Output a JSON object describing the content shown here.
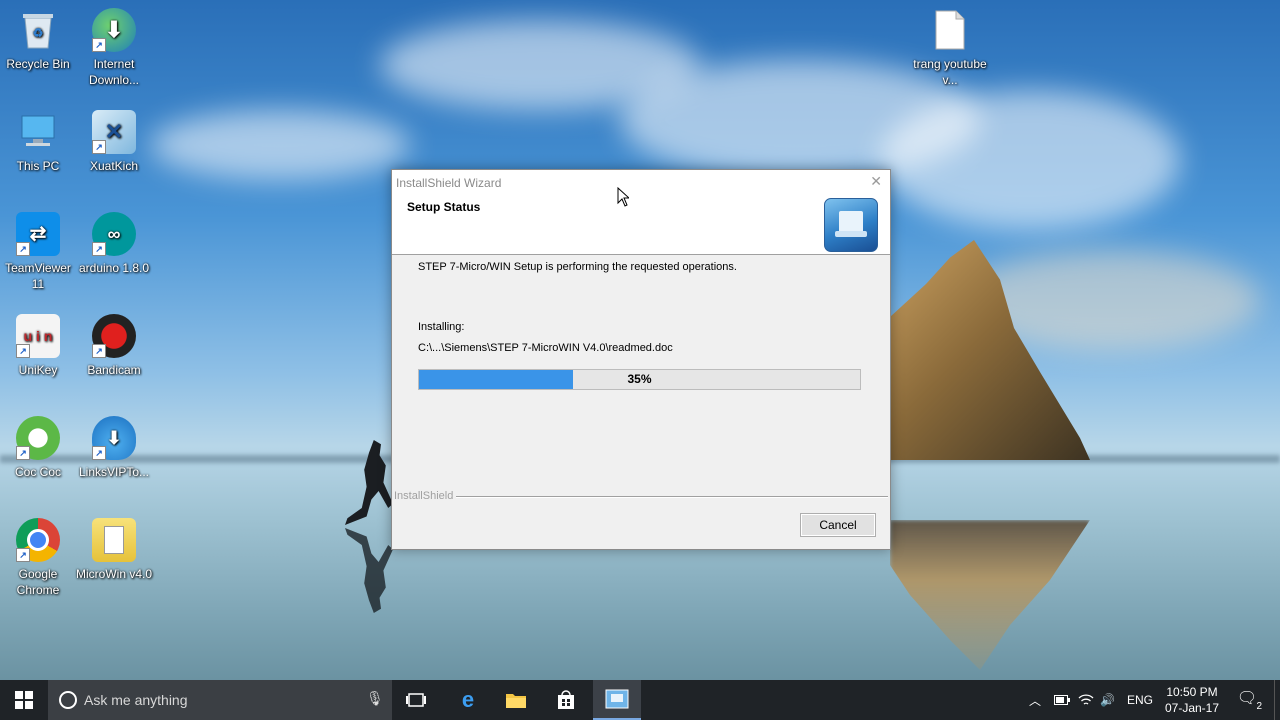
{
  "desktop": {
    "icons": [
      {
        "label": "Recycle Bin",
        "icon": "recycle-bin-icon"
      },
      {
        "label": "Internet Downlo...",
        "icon": "internet-download-manager-icon"
      },
      {
        "label": "This PC",
        "icon": "this-pc-icon"
      },
      {
        "label": "XuatKich",
        "icon": "xuatkich-icon"
      },
      {
        "label": "TeamViewer 11",
        "icon": "teamviewer-icon"
      },
      {
        "label": "arduino 1.8.0",
        "icon": "arduino-icon"
      },
      {
        "label": "UniKey",
        "icon": "unikey-icon"
      },
      {
        "label": "Bandicam",
        "icon": "bandicam-icon"
      },
      {
        "label": "Coc Coc",
        "icon": "coccoc-icon"
      },
      {
        "label": "LinksVIPTo...",
        "icon": "linksvip-icon"
      },
      {
        "label": "Google Chrome",
        "icon": "chrome-icon"
      },
      {
        "label": "MicroWin v4.0",
        "icon": "microwin-icon"
      },
      {
        "label": "trang youtube v...",
        "icon": "document-icon"
      }
    ]
  },
  "dialog": {
    "title": "InstallShield Wizard",
    "close_glyph": "✕",
    "header_title": "Setup Status",
    "status_message": "STEP 7-Micro/WIN Setup is performing the requested operations.",
    "installing_label": "Installing:",
    "current_file": "C:\\...\\Siemens\\STEP 7-MicroWIN V4.0\\readmed.doc",
    "progress_percent": 35,
    "progress_text": "35%",
    "brand": "InstallShield",
    "cancel_label": "Cancel"
  },
  "taskbar": {
    "search_placeholder": "Ask me anything",
    "language": "ENG",
    "time": "10:50 PM",
    "date": "07-Jan-17",
    "notification_count": "2",
    "accent_color": "#3a94e8"
  }
}
